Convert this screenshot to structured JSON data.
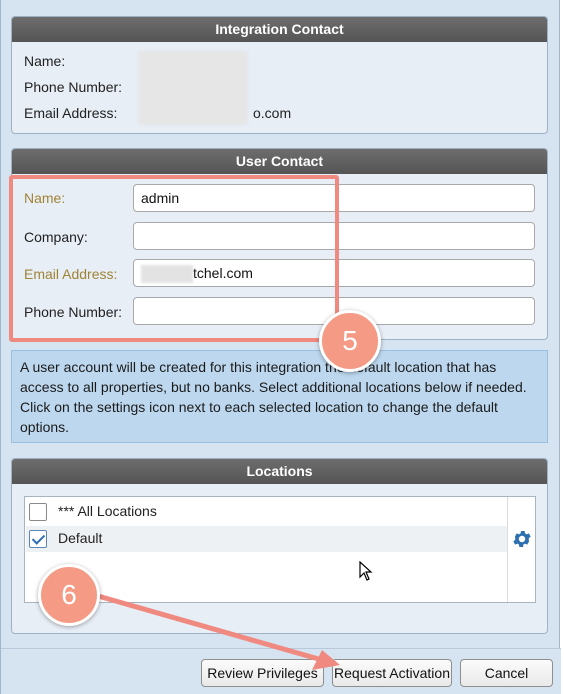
{
  "integration_contact": {
    "header": "Integration Contact",
    "name_label": "Name:",
    "phone_label": "Phone Number:",
    "email_label": "Email Address:",
    "email_visible_suffix": "o.com"
  },
  "user_contact": {
    "header": "User Contact",
    "name_label": "Name:",
    "name_value": "admin",
    "company_label": "Company:",
    "company_value": "",
    "email_label": "Email Address:",
    "email_visible_suffix": "tchel.com",
    "phone_label": "Phone Number:",
    "phone_value": ""
  },
  "info_text": "A user account will be created for this integration the default location that has access to all properties, but no banks. Select additional locations below if needed. Click on the settings icon next to each selected location to change the default options.",
  "locations": {
    "header": "Locations",
    "items": [
      {
        "label": "*** All Locations",
        "checked": false
      },
      {
        "label": "Default",
        "checked": true
      }
    ]
  },
  "buttons": {
    "review": "Review Privileges",
    "request": "Request Activation",
    "cancel": "Cancel"
  },
  "annotations": {
    "step5": "5",
    "step6": "6",
    "color": "#f59a84"
  },
  "colors": {
    "panel_header": "#5f5f5f",
    "required_label": "#a08436",
    "info_bg": "#bcd7ee",
    "dialog_bg": "#d6e4f2",
    "highlight": "#f08a80"
  }
}
